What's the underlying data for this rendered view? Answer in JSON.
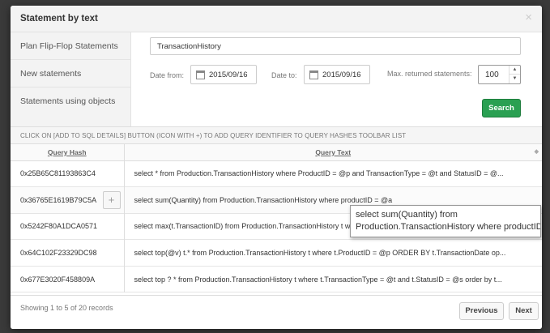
{
  "modal": {
    "title": "Statement by text",
    "close": "×"
  },
  "sidebar": {
    "items": [
      {
        "label": "Plan Flip-Flop Statements"
      },
      {
        "label": "New statements"
      },
      {
        "label": "Statements using objects"
      }
    ]
  },
  "search": {
    "text_value": "TransactionHistory"
  },
  "filters": {
    "date_from_label": "Date from:",
    "date_from_value": "2015/09/16",
    "date_to_label": "Date to:",
    "date_to_value": "2015/09/16",
    "max_label": "Max. returned statements:",
    "max_value": "100",
    "search_button": "Search"
  },
  "hint": "CLICK ON [ADD TO SQL DETAILS] BUTTON (ICON WITH +) TO ADD QUERY IDENTIFIER TO QUERY HASHES TOOLBAR LIST",
  "table": {
    "columns": [
      "Query Hash",
      "Query Text"
    ],
    "rows": [
      {
        "hash": "0x25B65C81193863C4",
        "text": "select * from Production.TransactionHistory where ProductID = @p and TransactionType = @t and StatusID = @..."
      },
      {
        "hash": "0x36765E1619B79C5A",
        "text": "select sum(Quantity) from Production.TransactionHistory where productID = @a"
      },
      {
        "hash": "0x5242F80A1DCA0571",
        "text": "select max(t.TransactionID) from Production.TransactionHistory t where t.ProductID = @p"
      },
      {
        "hash": "0x64C102F23329DC98",
        "text": "select top(@v) t.* from Production.TransactionHistory t where t.ProductID = @p ORDER BY t.TransactionDate op..."
      },
      {
        "hash": "0x677E3020F458809A",
        "text": "select top ? * from Production.TransactionHistory t where t.TransactionType = @t and t.StatusID = @s order by t..."
      }
    ],
    "add_button": "+"
  },
  "tooltip": {
    "line1": "select sum(Quantity) from",
    "line2": "Production.TransactionHistory where productID = @a"
  },
  "footer": {
    "info": "Showing 1 to 5 of 20 records",
    "previous": "Previous",
    "next": "Next"
  },
  "colors": {
    "search_button": "#2aa052"
  }
}
